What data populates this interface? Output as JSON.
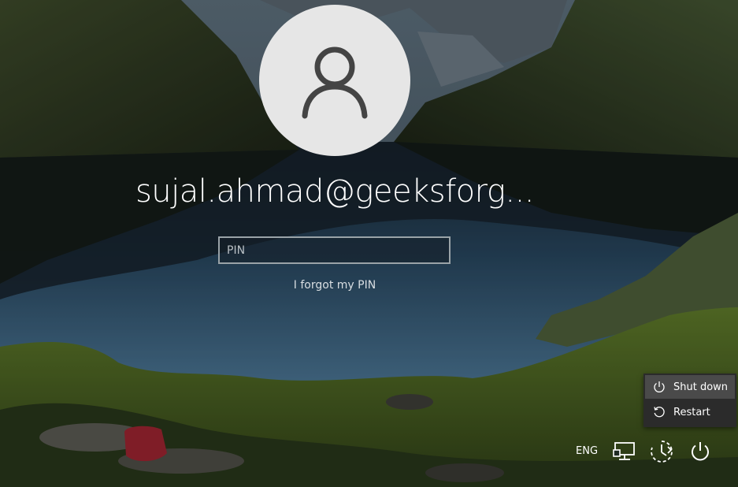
{
  "user": {
    "display_name": "sujal.ahmad@geeksforg..."
  },
  "pin": {
    "placeholder": "PIN",
    "value": ""
  },
  "forgot_pin_label": "I forgot my PIN",
  "power_menu": {
    "items": [
      {
        "label": "Shut down",
        "icon": "power-icon",
        "highlighted": true
      },
      {
        "label": "Restart",
        "icon": "restart-icon",
        "highlighted": false
      }
    ]
  },
  "tray": {
    "language": "ENG",
    "icons": [
      "network-icon",
      "ease-of-access-icon",
      "power-icon"
    ]
  },
  "colors": {
    "text": "#ffffff",
    "avatar_bg": "#e6e6e6",
    "avatar_glyph": "#444444",
    "menu_bg": "#2b2b2b",
    "menu_hover": "#4a4a4a"
  }
}
